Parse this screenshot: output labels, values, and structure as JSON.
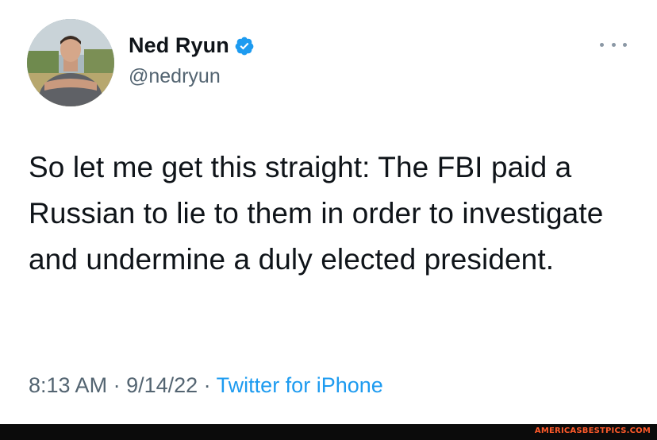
{
  "author": {
    "display_name": "Ned Ryun",
    "handle": "@nedryun",
    "verified": true,
    "avatar_icon": "profile-photo"
  },
  "tweet": {
    "text": "So let me get this straight: The FBI paid a Russian to lie to them in order to investigate and undermine a duly elected president."
  },
  "meta": {
    "time": "8:13 AM",
    "separator": " · ",
    "date": "9/14/22",
    "source": "Twitter for iPhone"
  },
  "more_icon": "more-horizontal-icon",
  "watermark": "AMERICASBESTPICS.COM",
  "colors": {
    "text": "#0f1419",
    "secondary": "#536471",
    "link": "#1d9bf0",
    "verified": "#1d9bf0",
    "watermark": "#ff5a2a"
  }
}
